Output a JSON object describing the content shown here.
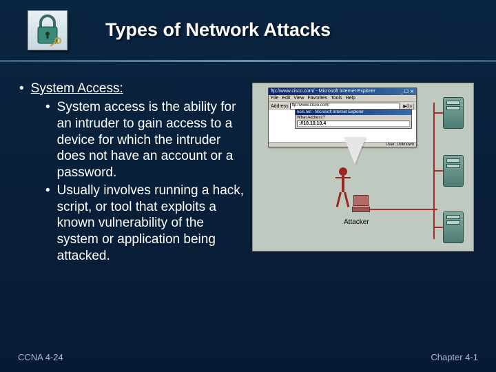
{
  "header": {
    "title": "Types of Network Attacks",
    "icon_name": "padlock-key-icon"
  },
  "content": {
    "heading": "System Access:",
    "sub1": "System access is the ability for an intruder to gain access to a device for which the intruder does not have an account or a password.",
    "sub2": "Usually involves running a hack, script, or tool that exploits a known vulnerability of the system or application being attacked."
  },
  "illustration": {
    "browser_title": "ftp://www.cisco.com/ - Microsoft Internet Explorer",
    "menu": [
      "File",
      "Edit",
      "View",
      "Favorites",
      "Tools",
      "Help"
    ],
    "address_label": "Address",
    "url": "ftp://www.cisco.com/",
    "go": "Go",
    "inner_title": "nols.net - Microsoft Internet Explorer",
    "inner_text": "What Address?",
    "ip": "://10.10.10.4",
    "status_user": "User: Unknown",
    "attacker_label": "Attacker"
  },
  "footer": {
    "left": "CCNA 4-24",
    "right": "Chapter 4-1"
  }
}
